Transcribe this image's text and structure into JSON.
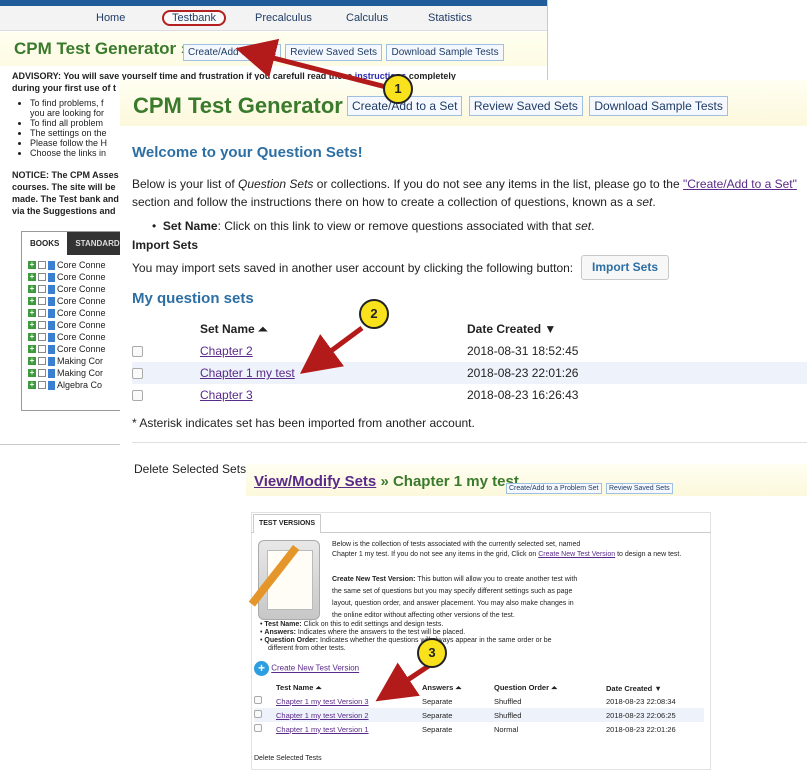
{
  "back": {
    "nav": [
      "Home",
      "Testbank",
      "Precalculus",
      "Calculus",
      "Statistics"
    ],
    "title": "CPM Test Generator »",
    "buttons": [
      "Create/Add to a Set",
      "Review Saved Sets",
      "Download Sample Tests"
    ],
    "advisory_a": "ADVISORY: You will save yourself time and frustration if you carefull read these",
    "advisory_link": "instructions",
    "advisory_b": "completely",
    "advisory_c": "during your first use of t",
    "bullets": [
      "To find problems, f",
      "you are looking for",
      "To find all problem",
      "The settings on the",
      "Please follow the H",
      "Choose the links in"
    ],
    "notice": [
      "NOTICE: The CPM Asses",
      "courses. The site will be",
      "made. The Test bank and",
      "via the Suggestions and"
    ],
    "book_tabs": [
      "BOOKS",
      "STANDARD"
    ],
    "books": [
      "Core Conne",
      "Core Conne",
      "Core Conne",
      "Core Conne",
      "Core Conne",
      "Core Conne",
      "Core Conne",
      "Core Conne",
      "Making Cor",
      "Making Cor",
      "Algebra Co"
    ]
  },
  "mid": {
    "title": "CPM Test Generator »",
    "buttons": [
      "Create/Add to a Set",
      "Review Saved Sets",
      "Download Sample Tests"
    ],
    "welcome": "Welcome to your Question Sets!",
    "intro_a": "Below is your list of",
    "intro_em": "Question Sets",
    "intro_b": "or collections. If you do not see any items in the list, please go to the",
    "intro_link": "\"Create/Add to a Set\"",
    "intro_c": "section and follow the instructions there on how to create a collection of questions, known as a",
    "intro_set": "set",
    "bullet_label": "Set Name",
    "bullet_text": ": Click on this link to view or remove questions associated with that",
    "bullet_set": "set",
    "import_heading": "Import Sets",
    "import_text": "You may import sets saved in another user account by clicking the following button:",
    "import_button": "Import Sets",
    "my_sets": "My question sets",
    "col_name": "Set Name",
    "col_date": "Date Created",
    "rows": [
      {
        "name": "Chapter 2",
        "date": "2018-08-31 18:52:45"
      },
      {
        "name": "Chapter 1 my test",
        "date": "2018-08-23 22:01:26"
      },
      {
        "name": "Chapter 3",
        "date": "2018-08-23 16:26:43"
      }
    ],
    "footnote": "* Asterisk indicates set has been imported from another account.",
    "delete": "Delete Selected Sets"
  },
  "front": {
    "title_link": "View/Modify Sets",
    "title_rest": "» Chapter 1 my test",
    "buttons": [
      "Create/Add to a Problem Set",
      "Review Saved Sets"
    ],
    "tab": "TEST VERSIONS",
    "desc_a": "Below is the collection of tests associated with the currently selected set, named",
    "desc_b": "Chapter 1 my test. If you do not see any items in the grid, Click on",
    "desc_link": "Create New Test Version",
    "desc_c": "to design a new test.",
    "cntv_label": "Create New Test Version:",
    "cntv_lines": [
      "This button will allow you to create another test with",
      "the same set of questions but you may specify different settings such as page",
      "layout, question order, and answer placement. You may also make changes in",
      "the online editor without affecting other versions of the test."
    ],
    "bullets": [
      {
        "label": "Test Name:",
        "text": "Click on this to edit settings and design tests."
      },
      {
        "label": "Answers:",
        "text": "Indicates where the answers to the test will be placed."
      },
      {
        "label": "Question Order:",
        "text": "Indicates whether the questions will always appear in the same order or be"
      }
    ],
    "bullet_cont": "different from other tests.",
    "new_version": "Create New Test Version",
    "cols": [
      "Test Name",
      "Answers",
      "Question Order",
      "Date Created"
    ],
    "rows": [
      {
        "name": "Chapter 1 my test Version 3",
        "answers": "Separate",
        "order": "Shuffled",
        "date": "2018-08-23 22:08:34"
      },
      {
        "name": "Chapter 1 my test Version 2",
        "answers": "Separate",
        "order": "Shuffled",
        "date": "2018-08-23 22:06:25"
      },
      {
        "name": "Chapter 1 my test Version 1",
        "answers": "Separate",
        "order": "Normal",
        "date": "2018-08-23 22:01:26"
      }
    ],
    "delete": "Delete Selected Tests"
  },
  "callouts": [
    "1",
    "2",
    "3"
  ],
  "colors": {
    "arrow": "#b31b1b",
    "badge": "#f9e11c",
    "title_green": "#3a7a2c",
    "heading_blue": "#2d6fa3",
    "link_purple": "#5a2a8a"
  }
}
